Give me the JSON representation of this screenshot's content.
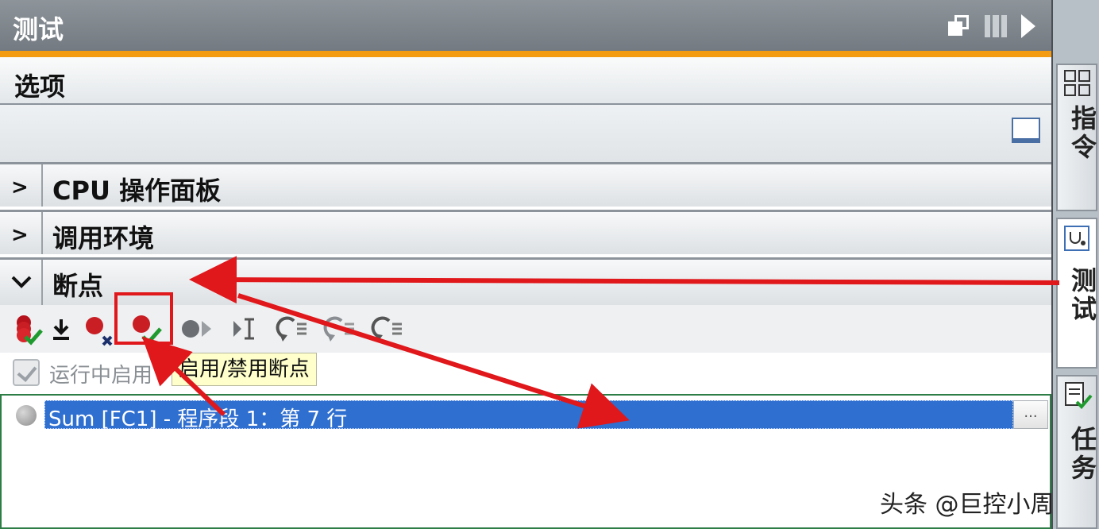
{
  "titlebar": {
    "title": "测试"
  },
  "options": {
    "label": "选项"
  },
  "sections": [
    {
      "label": "CPU 操作面板",
      "chevron": ">"
    },
    {
      "label": "调用环境",
      "chevron": ">"
    },
    {
      "label": "断点",
      "chevron": "⌄"
    }
  ],
  "toolbar": {
    "icons": [
      "breakpoints-stack-icon",
      "download-icon",
      "delete-breakpoint-icon",
      "enable-disable-breakpoint-icon",
      "run-to-icon",
      "step-over-icon",
      "step-into-icon",
      "step-out-icon",
      "step-return-icon"
    ]
  },
  "checkbox": {
    "label": "运行中启用",
    "checked": true
  },
  "tooltip": {
    "text": "启用/禁用断点"
  },
  "breakpoints": [
    {
      "text": "Sum [FC1] - 程序段 1：第 7 行",
      "more": "..."
    }
  ],
  "side_tabs": [
    "指令",
    "测试",
    "任务"
  ],
  "watermark": "头条 @巨控小周",
  "colors": {
    "accent": "#f39c12",
    "selection": "#2f6fd0",
    "annotation": "#e0171b"
  }
}
